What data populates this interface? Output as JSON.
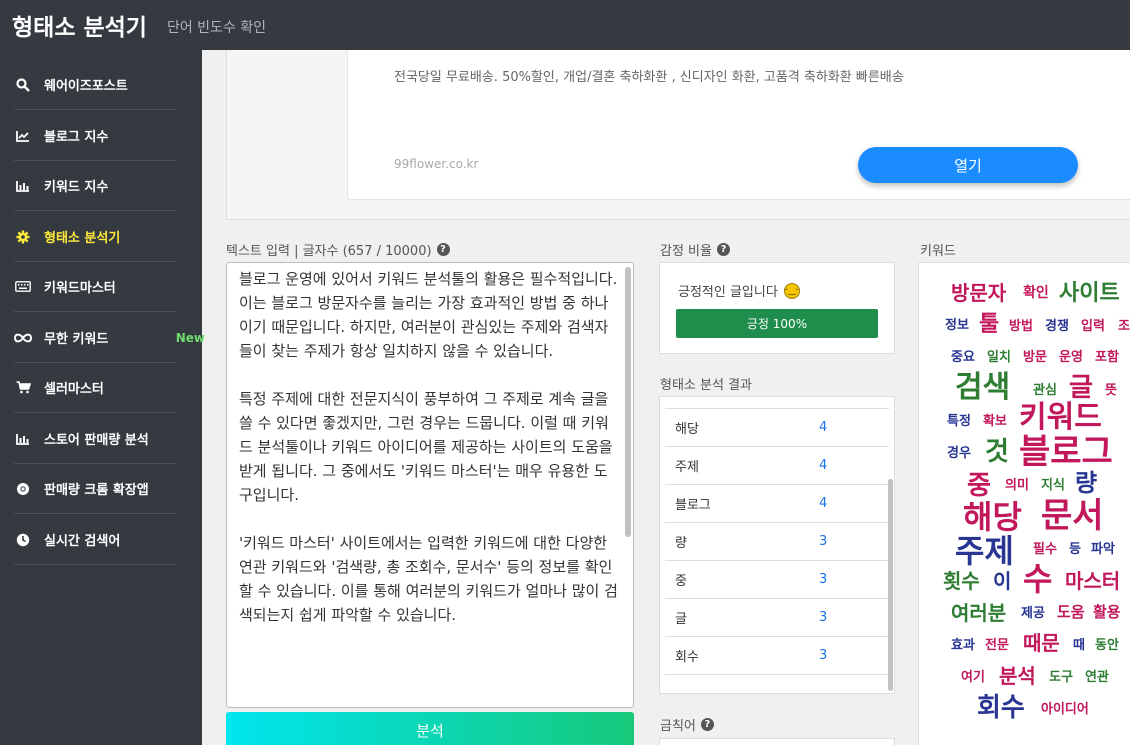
{
  "header": {
    "title": "형태소 분석기",
    "subtitle": "단어 빈도수 확인"
  },
  "sidebar": {
    "items": [
      {
        "label": "웨어이즈포스트",
        "icon": "search-icon"
      },
      {
        "label": "블로그 지수",
        "icon": "line-chart-icon"
      },
      {
        "label": "키워드 지수",
        "icon": "bar-chart-icon"
      },
      {
        "label": "형태소 분석기",
        "icon": "gear-icon",
        "active": true
      },
      {
        "label": "키워드마스터",
        "icon": "keyboard-icon"
      },
      {
        "label": "무한 키워드",
        "icon": "infinity-icon",
        "badge": "New"
      },
      {
        "label": "셀러마스터",
        "icon": "cart-icon"
      },
      {
        "label": "스토어 판매량 분석",
        "icon": "bar-chart-icon"
      },
      {
        "label": "판매량 크롬 확장앱",
        "icon": "chrome-icon"
      },
      {
        "label": "실시간 검색어",
        "icon": "clock-icon"
      }
    ]
  },
  "ad": {
    "text": "전국당일 무료배송. 50%할인, 개업/결혼 축하화환 , 신디자인 화환, 고품격 축하화환 빠른배송",
    "domain": "99flower.co.kr",
    "button_label": "열기"
  },
  "text_input": {
    "label": "텍스트 입력 | 글자수 (657 / 10000)",
    "paragraphs": [
      "블로그 운영에 있어서 키워드 분석툴의 활용은 필수적입니다. 이는 블로그 방문자수를 늘리는 가장 효과적인 방법 중 하나이기 때문입니다. 하지만, 여러분이 관심있는 주제와 검색자들이 찾는 주제가 항상 일치하지 않을 수 있습니다.",
      "특정 주제에 대한 전문지식이 풍부하여 그 주제로 계속 글을 쓸 수 있다면 좋겠지만, 그런 경우는 드뭅니다. 이럴 때 키워드 분석툴이나 키워드 아이디어를 제공하는 사이트의 도움을 받게 됩니다. 그 중에서도 '키워드 마스터'는 매우 유용한 도구입니다.",
      "'키워드 마스터' 사이트에서는 입력한 키워드에 대한 다양한 연관 키워드와 '검색량, 총 조회수, 문서수' 등의 정보를 확인할 수 있습니다. 이를 통해 여러분의 키워드가 얼마나 많이 검색되는지 쉽게 파악할 수 있습니다."
    ],
    "analyze_label": "분석"
  },
  "emotion": {
    "label": "감정 비율",
    "text": "긍정적인 글입니다",
    "emoji": "smile-emoji",
    "bar_label": "긍정 100%",
    "positive_fraction": 1.0
  },
  "morph": {
    "label": "형태소 분석 결과",
    "rows": [
      {
        "word": "해당",
        "count": "4"
      },
      {
        "word": "주제",
        "count": "4"
      },
      {
        "word": "블로그",
        "count": "4"
      },
      {
        "word": "량",
        "count": "3"
      },
      {
        "word": "중",
        "count": "3"
      },
      {
        "word": "글",
        "count": "3"
      },
      {
        "word": "회수",
        "count": "3"
      }
    ]
  },
  "stopwords": {
    "label": "금칙어"
  },
  "cloud": {
    "label": "키워드",
    "words": [
      {
        "text": "방문자",
        "color": "#c2185b"
      },
      {
        "text": "확인",
        "color": "#c2185b"
      },
      {
        "text": "사이트",
        "color": "#2e7d32"
      },
      {
        "text": "정보",
        "color": "#283593"
      },
      {
        "text": "툴",
        "color": "#c2185b"
      },
      {
        "text": "방법",
        "color": "#c2185b"
      },
      {
        "text": "경쟁",
        "color": "#283593"
      },
      {
        "text": "입력",
        "color": "#c2185b"
      },
      {
        "text": "조",
        "color": "#c2185b"
      },
      {
        "text": "중요",
        "color": "#283593"
      },
      {
        "text": "일치",
        "color": "#2e7d32"
      },
      {
        "text": "방문",
        "color": "#c2185b"
      },
      {
        "text": "운영",
        "color": "#c2185b"
      },
      {
        "text": "포함",
        "color": "#c2185b"
      },
      {
        "text": "검색",
        "color": "#2e7d32"
      },
      {
        "text": "관심",
        "color": "#2e7d32"
      },
      {
        "text": "글",
        "color": "#c2185b"
      },
      {
        "text": "뜻",
        "color": "#c2185b"
      },
      {
        "text": "특정",
        "color": "#283593"
      },
      {
        "text": "확보",
        "color": "#c2185b"
      },
      {
        "text": "키워드",
        "color": "#c2185b"
      },
      {
        "text": "경우",
        "color": "#283593"
      },
      {
        "text": "것",
        "color": "#2e7d32"
      },
      {
        "text": "블로그",
        "color": "#c2185b"
      },
      {
        "text": "중",
        "color": "#c2185b"
      },
      {
        "text": "의미",
        "color": "#c2185b"
      },
      {
        "text": "지식",
        "color": "#2e7d32"
      },
      {
        "text": "량",
        "color": "#283593"
      },
      {
        "text": "해당",
        "color": "#c2185b"
      },
      {
        "text": "문서",
        "color": "#c2185b"
      },
      {
        "text": "주제",
        "color": "#283593"
      },
      {
        "text": "필수",
        "color": "#c2185b"
      },
      {
        "text": "등",
        "color": "#283593"
      },
      {
        "text": "파악",
        "color": "#283593"
      },
      {
        "text": "횟수",
        "color": "#2e7d32"
      },
      {
        "text": "이",
        "color": "#283593"
      },
      {
        "text": "수",
        "color": "#c2185b"
      },
      {
        "text": "마스터",
        "color": "#c2185b"
      },
      {
        "text": "여러분",
        "color": "#2e7d32"
      },
      {
        "text": "제공",
        "color": "#283593"
      },
      {
        "text": "도움",
        "color": "#c2185b"
      },
      {
        "text": "활용",
        "color": "#c2185b"
      },
      {
        "text": "효과",
        "color": "#283593"
      },
      {
        "text": "전문",
        "color": "#c2185b"
      },
      {
        "text": "때문",
        "color": "#c2185b"
      },
      {
        "text": "때",
        "color": "#283593"
      },
      {
        "text": "동안",
        "color": "#2e7d32"
      },
      {
        "text": "여기",
        "color": "#c2185b"
      },
      {
        "text": "분석",
        "color": "#c2185b"
      },
      {
        "text": "도구",
        "color": "#2e7d32"
      },
      {
        "text": "연관",
        "color": "#2e7d32"
      },
      {
        "text": "회수",
        "color": "#283593"
      },
      {
        "text": "아이디어",
        "color": "#c2185b"
      }
    ]
  }
}
